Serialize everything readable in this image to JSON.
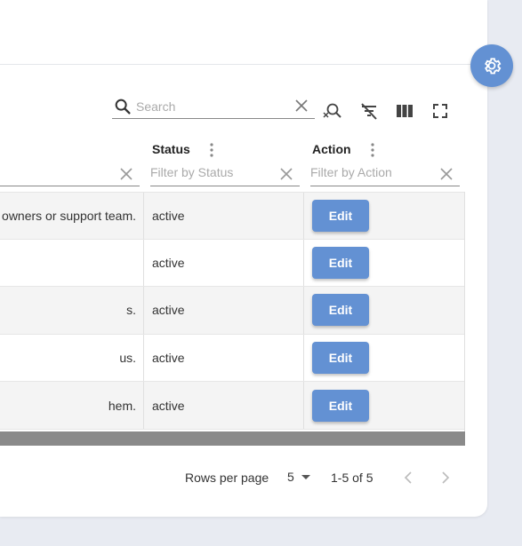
{
  "settings": {
    "icon": "gear-icon"
  },
  "toolbar": {
    "search_placeholder": "Search",
    "search_value": "",
    "icons": [
      "search-icon",
      "clear-icon",
      "search-off-icon",
      "filter-off-icon",
      "columns-icon",
      "fullscreen-icon"
    ]
  },
  "columns": {
    "status": {
      "label": "Status",
      "filter_placeholder": "Filter by Status"
    },
    "action": {
      "label": "Action",
      "filter_placeholder": "Filter by Action"
    }
  },
  "rows": [
    {
      "description": "owners or support team.",
      "status": "active",
      "action": "Edit"
    },
    {
      "description": "",
      "status": "active",
      "action": "Edit"
    },
    {
      "description": "s.",
      "status": "active",
      "action": "Edit"
    },
    {
      "description": "us.",
      "status": "active",
      "action": "Edit"
    },
    {
      "description": "hem.",
      "status": "active",
      "action": "Edit"
    }
  ],
  "pagination": {
    "rows_per_page_label": "Rows per page",
    "rows_per_page_value": "5",
    "range": "1-5 of 5"
  },
  "colors": {
    "accent": "#6391d3",
    "background": "#e8ebf2"
  }
}
